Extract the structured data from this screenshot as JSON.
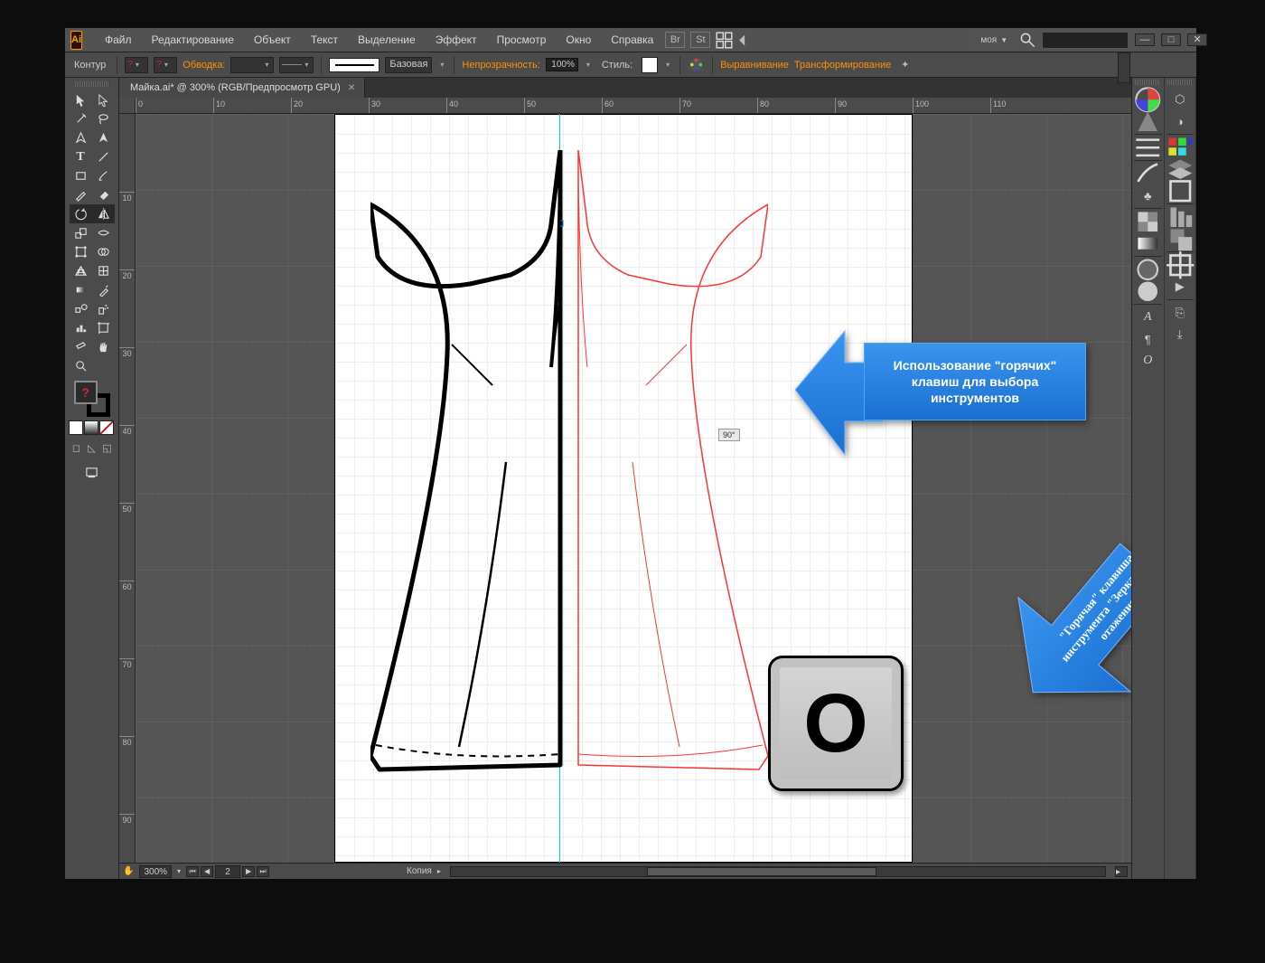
{
  "app_logo_text": "Ai",
  "menu": [
    "Файл",
    "Редактирование",
    "Объект",
    "Текст",
    "Выделение",
    "Эффект",
    "Просмотр",
    "Окно",
    "Справка"
  ],
  "workspace": "моя",
  "control_bar": {
    "left_label": "Контур",
    "stroke_label": "Обводка:",
    "stroke_weight": "",
    "brush_label": "Базовая",
    "opacity_label": "Непрозрачность:",
    "opacity_value": "100%",
    "style_label": "Стиль:",
    "align_link": "Выравнивание",
    "transform_link": "Трансформирование"
  },
  "document": {
    "tab_title": "Майка.ai* @ 300% (RGB/Предпросмотр GPU)",
    "zoom": "300%",
    "artboard_index": "2",
    "artboard_name": "Копия",
    "rotation_hint": "90°"
  },
  "ruler_h": [
    "0",
    "10",
    "20",
    "30",
    "40",
    "50",
    "60",
    "70",
    "80",
    "90",
    "100",
    "110"
  ],
  "ruler_v": [
    "10",
    "20",
    "30",
    "40",
    "50",
    "60",
    "70",
    "80",
    "90"
  ],
  "callout1": "Использование \"горячих\" клавиш для выбора инструментов",
  "callout2": "\"Горячая\" клавиша инструмента \"Зеркальное отажение\"",
  "keycap": "O"
}
